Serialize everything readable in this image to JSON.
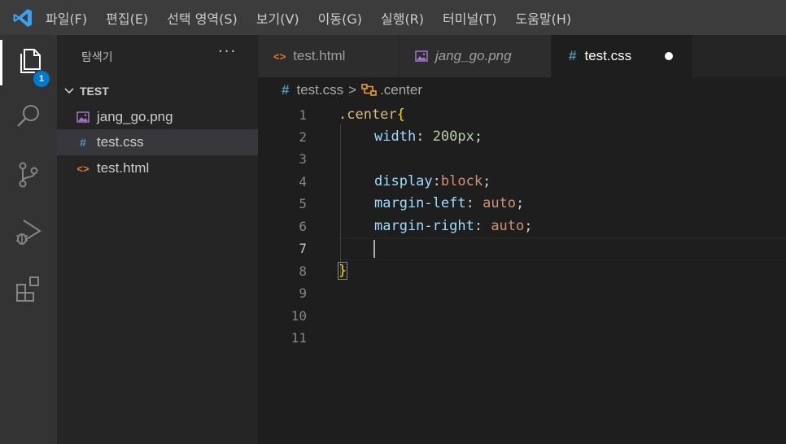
{
  "titlebar": {
    "menu": [
      "파일(F)",
      "편집(E)",
      "선택 영역(S)",
      "보기(V)",
      "이동(G)",
      "실행(R)",
      "터미널(T)",
      "도움말(H)"
    ]
  },
  "activity": {
    "items": [
      "explorer-icon",
      "search-icon",
      "source-control-icon",
      "run-debug-icon",
      "extensions-icon"
    ],
    "explorer_badge": "1"
  },
  "sidebar": {
    "title": "탐색기",
    "more": "···",
    "folder": "TEST",
    "files": [
      {
        "name": "jang_go.png",
        "icon": "image-file-icon",
        "selected": false
      },
      {
        "name": "test.css",
        "icon": "css-file-icon",
        "selected": true
      },
      {
        "name": "test.html",
        "icon": "html-file-icon",
        "selected": false
      }
    ]
  },
  "tabs": [
    {
      "label": "test.html",
      "icon_glyph": "<>",
      "active": false,
      "italic": false
    },
    {
      "label": "jang_go.png",
      "icon_glyph": "img",
      "active": false,
      "italic": true
    },
    {
      "label": "test.css",
      "icon_glyph": "#",
      "active": true,
      "italic": false,
      "modified": true
    }
  ],
  "breadcrumb": {
    "file_glyph": "#",
    "file": "test.css",
    "separator": ">",
    "symbol": ".center"
  },
  "editor": {
    "line_numbers": [
      "1",
      "2",
      "3",
      "4",
      "5",
      "6",
      "7",
      "8",
      "9",
      "10",
      "11"
    ],
    "current_line": "7",
    "code": {
      "l1_selector": ".center",
      "l1_brace": "{",
      "l2_prop": "width",
      "l2_colon": ": ",
      "l2_value": "200px",
      "l2_semi": ";",
      "l4_prop": "display",
      "l4_colon": ":",
      "l4_value": "block",
      "l4_semi": ";",
      "l5_prop": "margin-left",
      "l5_colon": ": ",
      "l5_value": "auto",
      "l5_semi": ";",
      "l6_prop": "margin-right",
      "l6_colon": ": ",
      "l6_value": "auto",
      "l6_semi": ";",
      "l8_brace": "}"
    }
  },
  "colors": {
    "accent": "#007acc",
    "selector": "#d7ba7d",
    "property": "#9cdcfe",
    "number": "#b5cea8",
    "string_value": "#ce9178",
    "bracket": "#ffd700"
  }
}
